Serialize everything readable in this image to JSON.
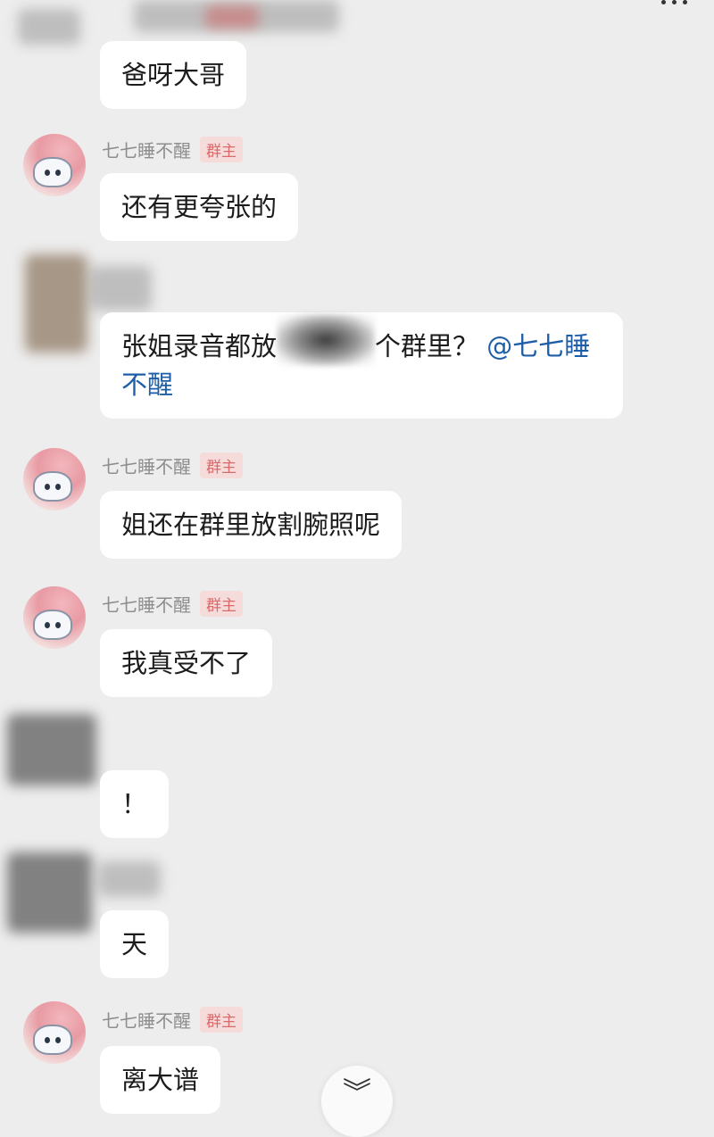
{
  "header": {
    "more_icon": "ellipsis-icon"
  },
  "messages": [
    {
      "sender": "",
      "badge": "",
      "text": "爸呀大哥"
    },
    {
      "sender": "七七睡不醒",
      "badge": "群主",
      "text": "还有更夸张的"
    },
    {
      "sender": "",
      "badge": "",
      "text_before": "张姐录音都放",
      "text_after": "个群里？",
      "mention": "@七七睡不醒"
    },
    {
      "sender": "七七睡不醒",
      "badge": "群主",
      "text": "姐还在群里放割腕照呢"
    },
    {
      "sender": "七七睡不醒",
      "badge": "群主",
      "text": "我真受不了"
    },
    {
      "sender": "",
      "badge": "",
      "text": "！"
    },
    {
      "sender": "",
      "badge": "",
      "text": "天"
    },
    {
      "sender": "七七睡不醒",
      "badge": "群主",
      "text": "离大谱"
    }
  ],
  "scroll_down_icon": "double-chevron-down-icon"
}
